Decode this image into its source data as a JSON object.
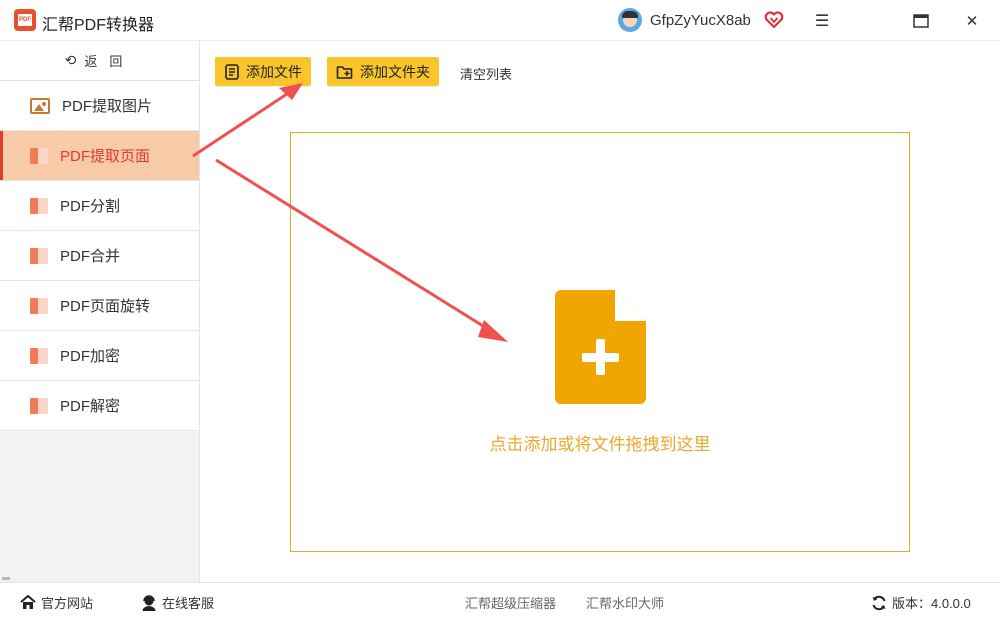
{
  "app": {
    "title": "汇帮PDF转换器",
    "logo_text": "PDF"
  },
  "user": {
    "name": "GfpZyYucX8ab"
  },
  "window_controls": {
    "menu_glyph": "☰",
    "maximize_glyph": "□",
    "close_glyph": "✕"
  },
  "sidebar": {
    "back_glyph": "⟲",
    "back_label": "返回",
    "items": [
      {
        "label": "PDF提取图片",
        "icon": "image-icon"
      },
      {
        "label": "PDF提取页面",
        "icon": "pdf-doc-icon",
        "active": true
      },
      {
        "label": "PDF分割",
        "icon": "pdf-doc-icon"
      },
      {
        "label": "PDF合并",
        "icon": "pdf-doc-icon"
      },
      {
        "label": "PDF页面旋转",
        "icon": "pdf-doc-icon"
      },
      {
        "label": "PDF加密",
        "icon": "pdf-doc-icon"
      },
      {
        "label": "PDF解密",
        "icon": "pdf-doc-icon"
      }
    ]
  },
  "toolbar": {
    "add_file_label": "添加文件",
    "add_folder_label": "添加文件夹",
    "clear_list_label": "清空列表"
  },
  "dropzone": {
    "hint": "点击添加或将文件拖拽到这里"
  },
  "footer": {
    "website_label": "官方网站",
    "support_label": "在线客服",
    "compressor_label": "汇帮超级压缩器",
    "watermark_label": "汇帮水印大师",
    "version_label": "版本：4.0.0.0"
  },
  "colors": {
    "accent_yellow": "#f9c52a",
    "drop_orange": "#e8a92c",
    "active_bg": "#f7caa8",
    "active_text": "#e03c2c",
    "arrow_red": "#f05050"
  }
}
